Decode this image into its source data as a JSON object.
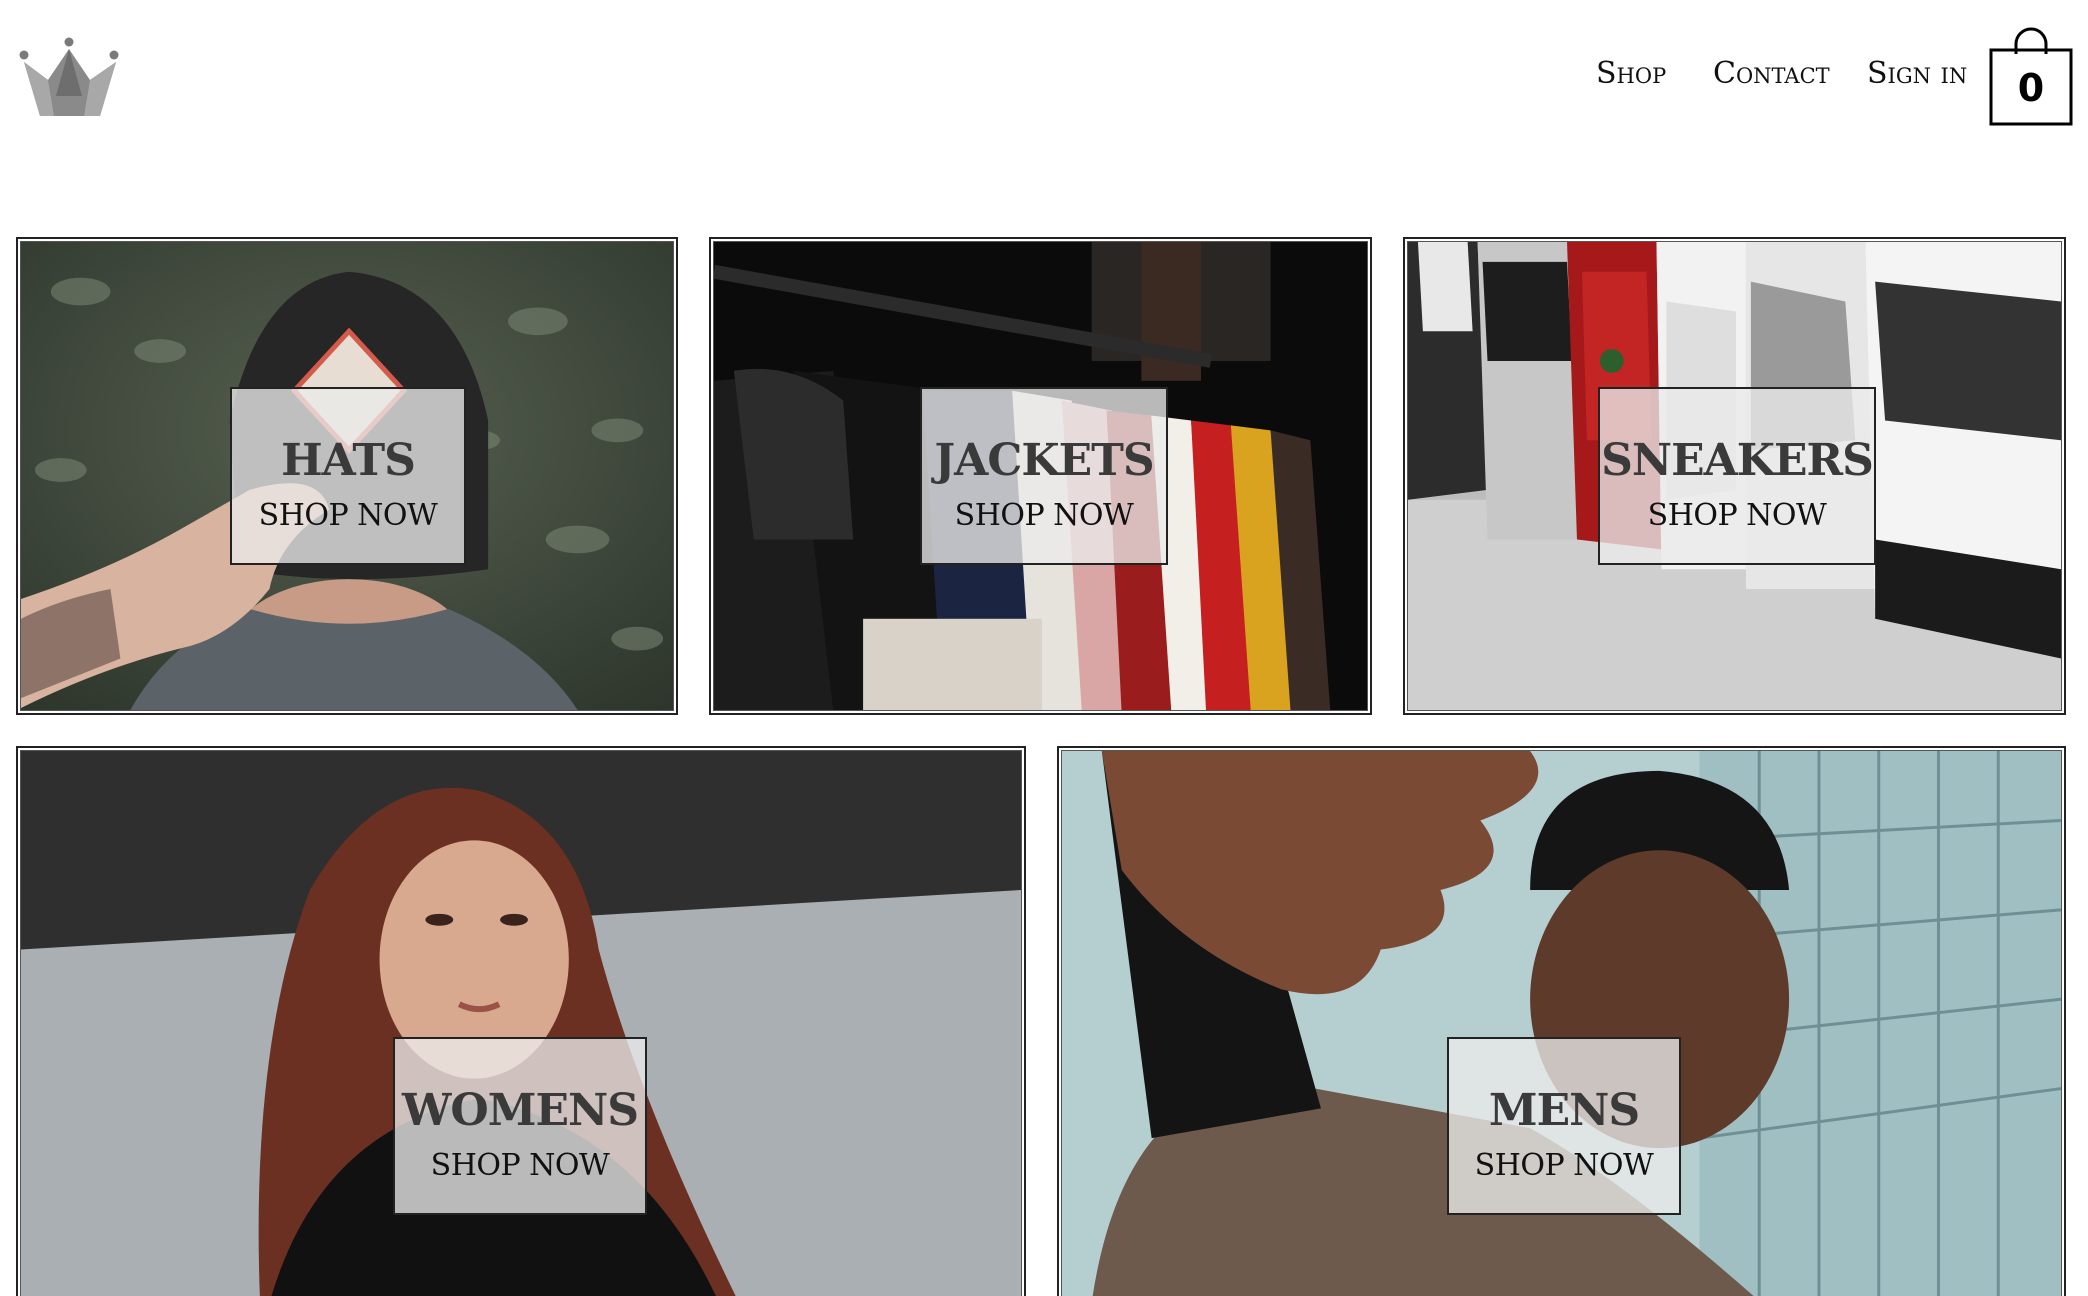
{
  "header": {
    "logo_icon": "crown-icon",
    "nav": {
      "shop": "Shop",
      "contact": "Contact",
      "sign_in": "Sign in"
    },
    "cart": {
      "icon": "shopping-bag-icon",
      "count": "0"
    }
  },
  "categories": [
    {
      "title": "HATS",
      "cta": "SHOP NOW"
    },
    {
      "title": "JACKETS",
      "cta": "SHOP NOW"
    },
    {
      "title": "SNEAKERS",
      "cta": "SHOP NOW"
    },
    {
      "title": "WOMENS",
      "cta": "SHOP NOW"
    },
    {
      "title": "MENS",
      "cta": "SHOP NOW"
    }
  ],
  "colors": {
    "text": "#111111",
    "border": "#222222",
    "label_bg": "#ebebeb",
    "logo_gray": "#7a7a7a"
  }
}
